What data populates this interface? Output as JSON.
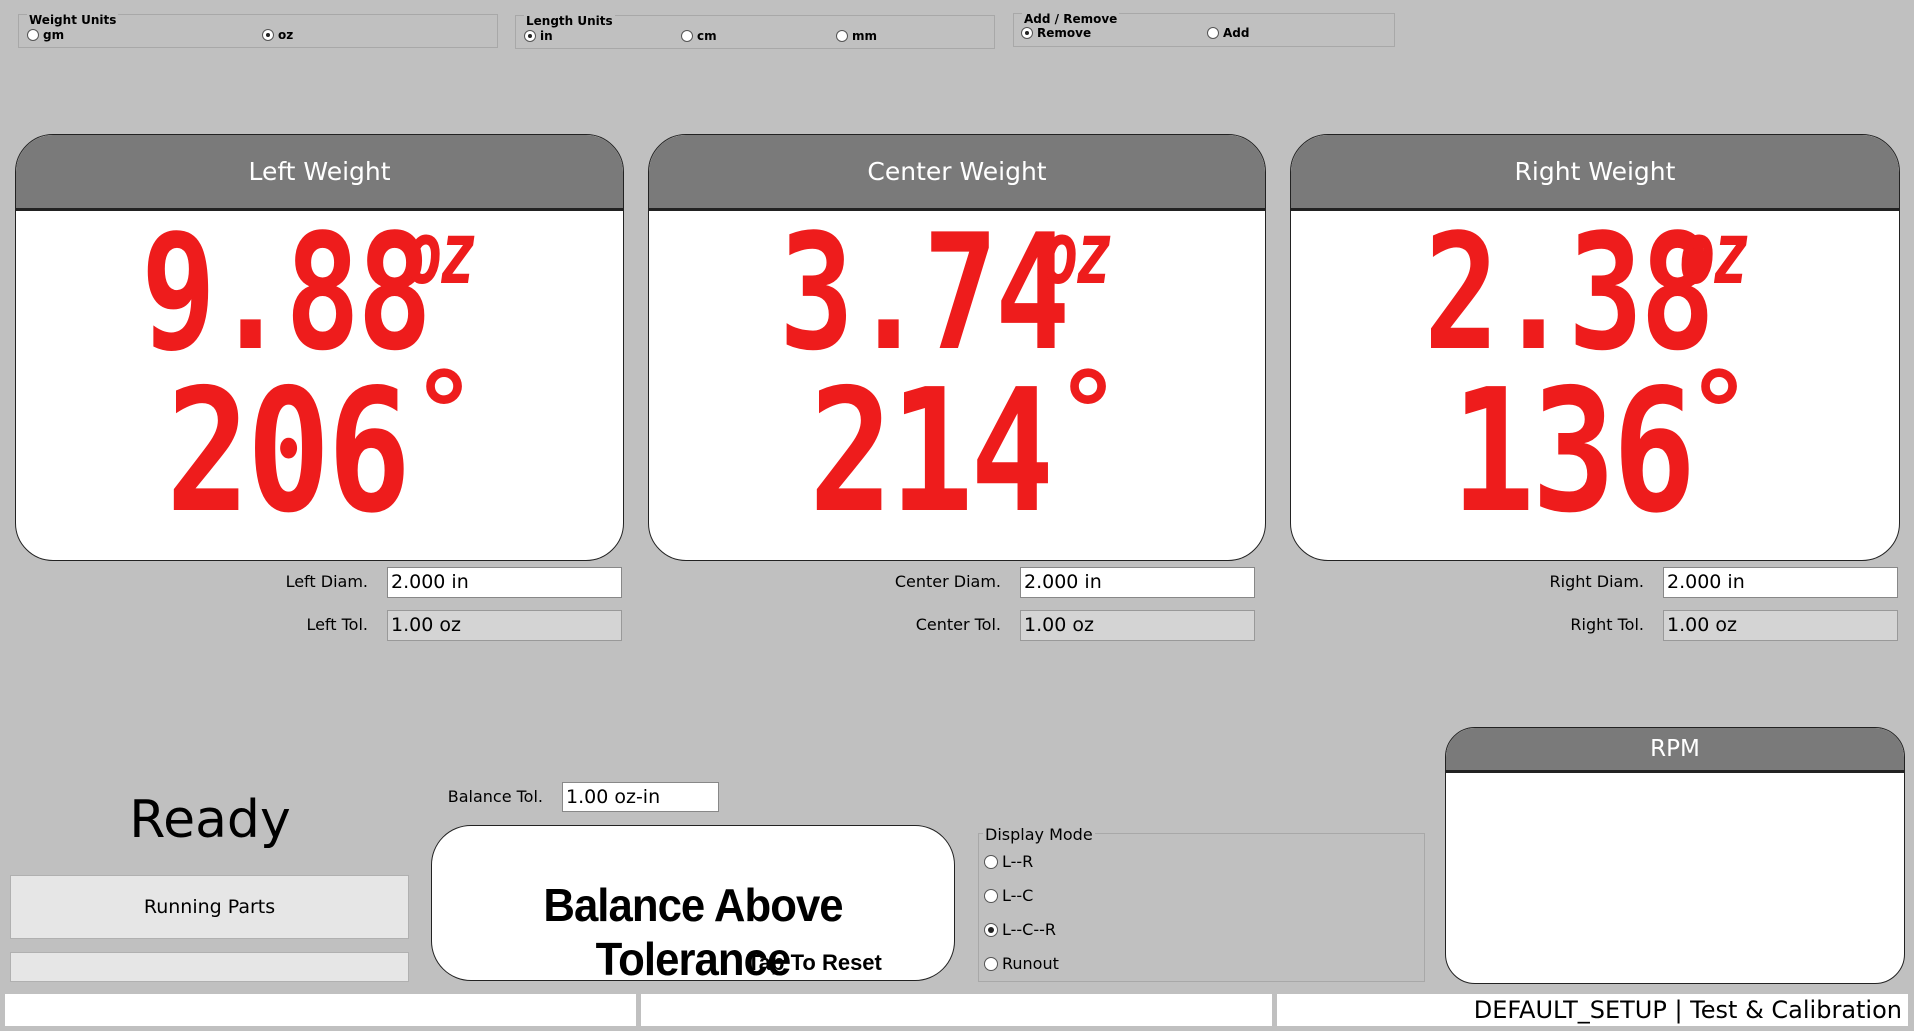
{
  "weight_units": {
    "title": "Weight Units",
    "options": [
      "gm",
      "oz"
    ],
    "selected": "oz"
  },
  "length_units": {
    "title": "Length Units",
    "options": [
      "in",
      "cm",
      "mm"
    ],
    "selected": "in"
  },
  "add_remove": {
    "title": "Add / Remove",
    "options": [
      "Remove",
      "Add"
    ],
    "selected": "Remove"
  },
  "panels": {
    "left": {
      "title": "Left Weight",
      "weight": "9.88",
      "unit": "oz",
      "angle": "206",
      "degree": "°",
      "diam_label": "Left Diam.",
      "diam_value": "2.000 in",
      "tol_label": "Left Tol.",
      "tol_value": "1.00 oz"
    },
    "center": {
      "title": "Center Weight",
      "weight": "3.74",
      "unit": "oz",
      "angle": "214",
      "degree": "°",
      "diam_label": "Center Diam.",
      "diam_value": "2.000 in",
      "tol_label": "Center Tol.",
      "tol_value": "1.00 oz"
    },
    "right": {
      "title": "Right Weight",
      "weight": "2.38",
      "unit": "oz",
      "angle": "136",
      "degree": "°",
      "diam_label": "Right Diam.",
      "diam_value": "2.000 in",
      "tol_label": "Right Tol.",
      "tol_value": "1.00 oz"
    }
  },
  "digit_color": "#ee1c1c",
  "status": {
    "state": "Ready",
    "running_button": "Running Parts"
  },
  "balance": {
    "tol_label": "Balance Tol.",
    "tol_value": "1.00 oz-in",
    "message": "Balance Above Tolerance",
    "reset_hint": "Tap To Reset"
  },
  "display_mode": {
    "title": "Display Mode",
    "options": [
      "L--R",
      "L--C",
      "L--C--R",
      "Runout"
    ],
    "selected": "L--C--R"
  },
  "rpm": {
    "title": "RPM",
    "value": ""
  },
  "status_bar": {
    "cell1": "",
    "cell2": "",
    "cell3": "DEFAULT_SETUP | Test & Calibration"
  }
}
